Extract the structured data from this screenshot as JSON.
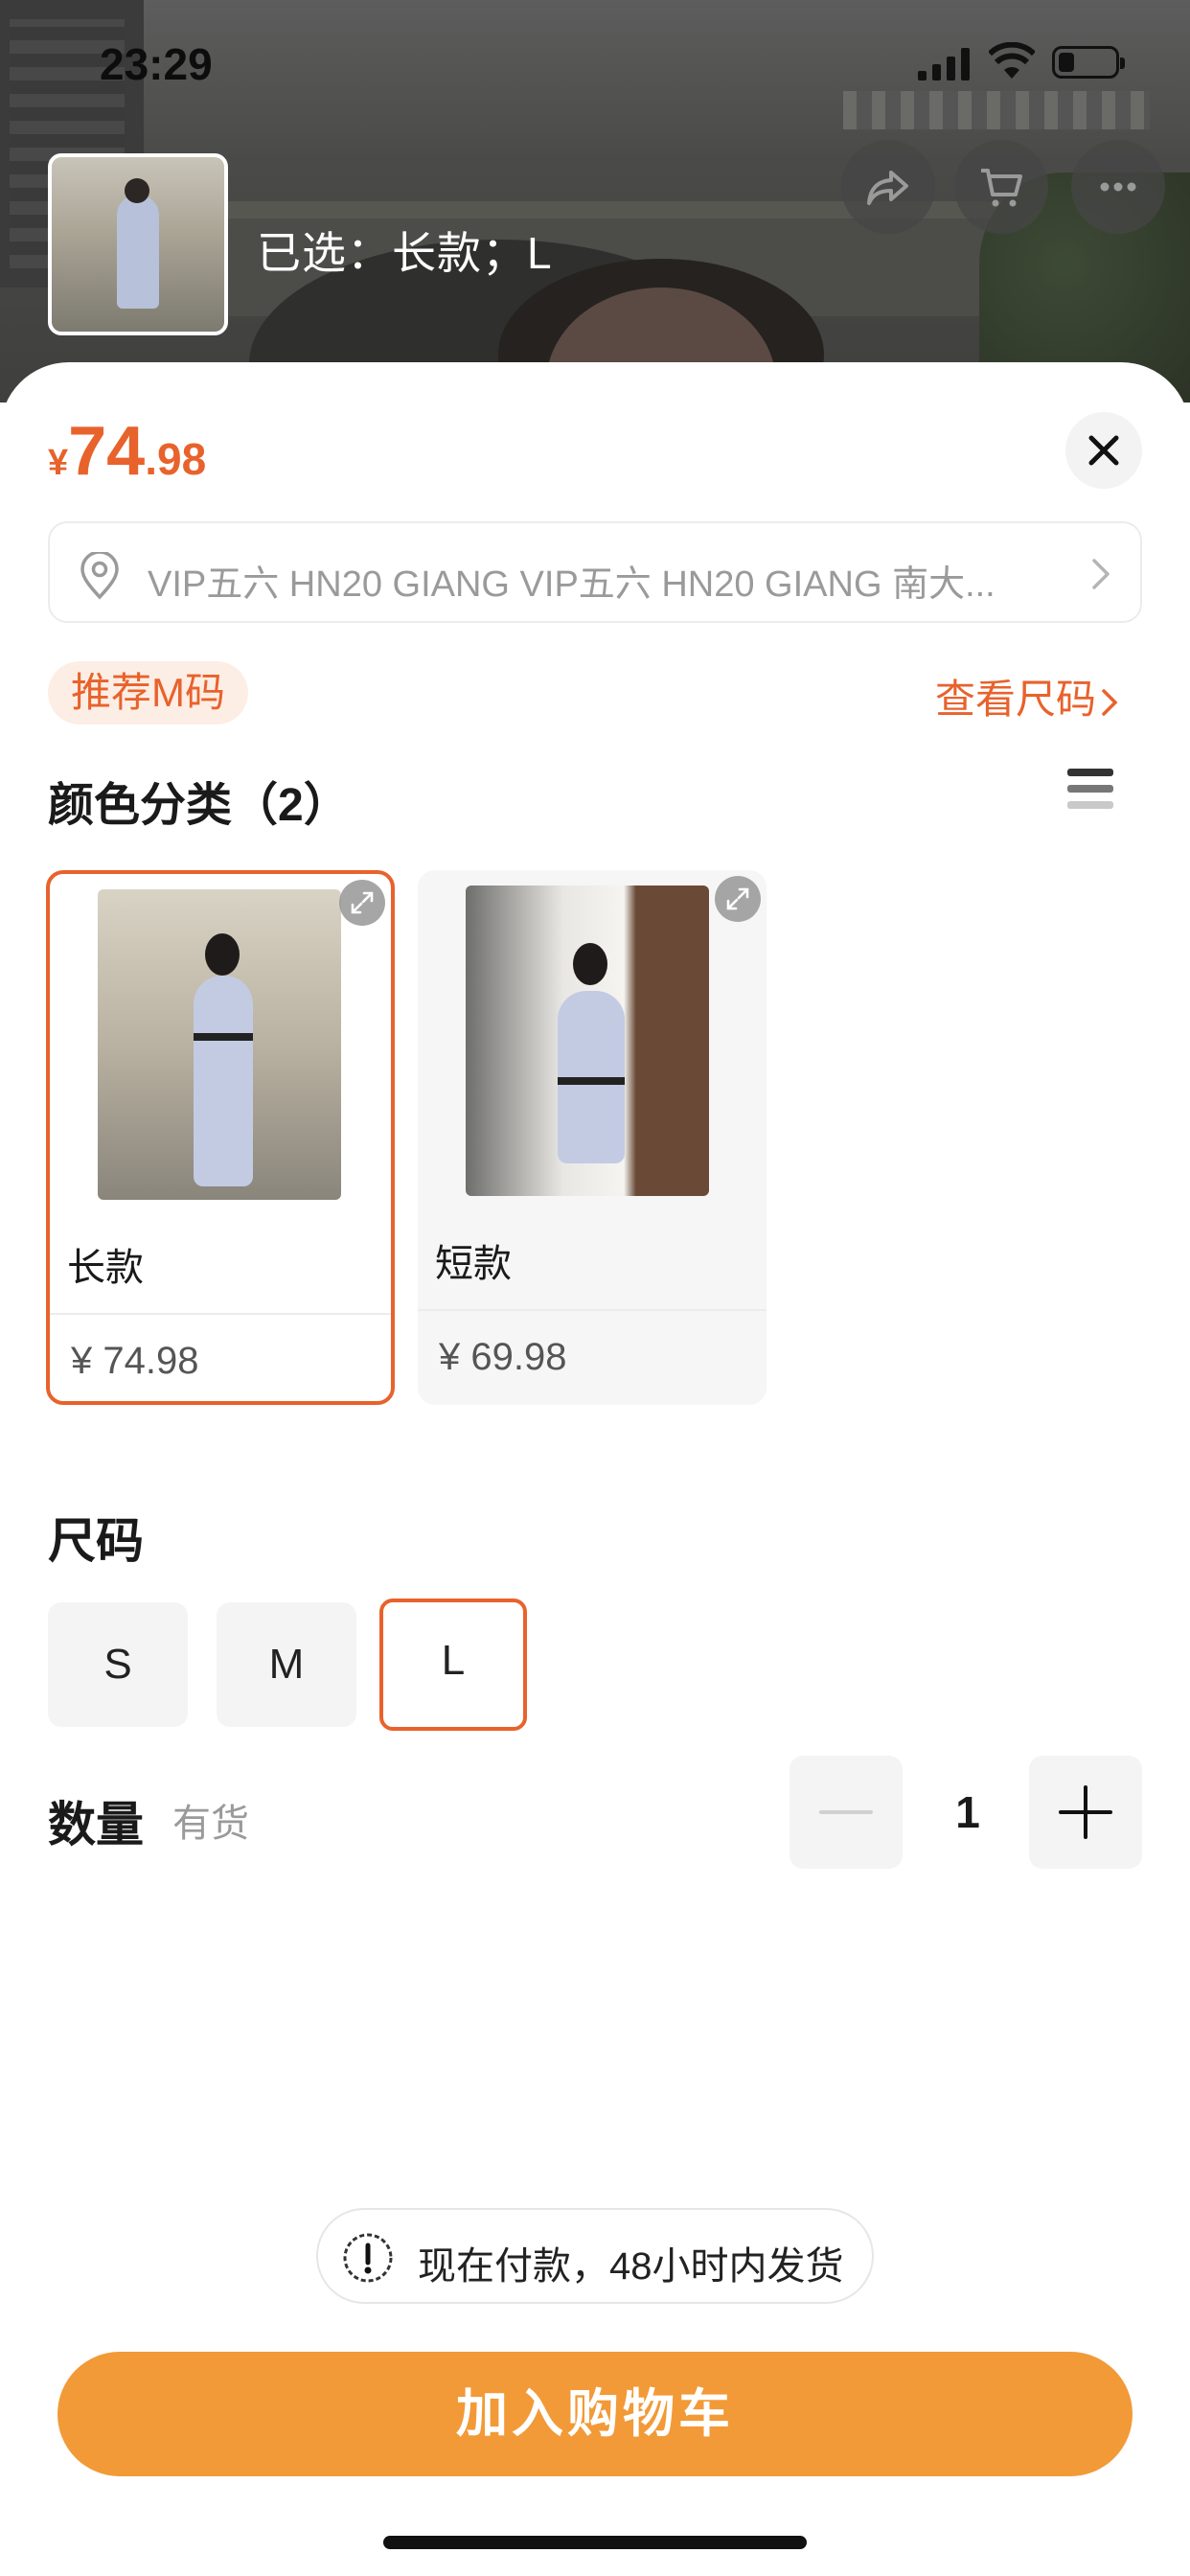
{
  "status_bar": {
    "time": "23:29"
  },
  "header": {
    "selected_text": "已选：长款；L"
  },
  "header_actions": [
    {
      "name": "share-icon"
    },
    {
      "name": "cart-icon"
    },
    {
      "name": "more-icon"
    }
  ],
  "price": {
    "currency": "¥",
    "integer": "74",
    "decimal": ".98",
    "color": "#e8622c"
  },
  "address": {
    "text": "VIP五六 HN20 GIANG VIP五六 HN20 GIANG 南大..."
  },
  "recommend_size": "推荐M码",
  "size_chart_link": "查看尺码",
  "color_section": {
    "title": "颜色分类（2）",
    "options": [
      {
        "name": "长款",
        "price": "¥ 74.98",
        "selected": true
      },
      {
        "name": "短款",
        "price": "¥ 69.98",
        "selected": false
      }
    ]
  },
  "size_section": {
    "title": "尺码",
    "options": [
      {
        "label": "S",
        "selected": false
      },
      {
        "label": "M",
        "selected": false
      },
      {
        "label": "L",
        "selected": true
      }
    ]
  },
  "quantity": {
    "title": "数量",
    "stock": "有货",
    "value": "1"
  },
  "notice": "现在付款，48小时内发货",
  "add_to_cart": "加入购物车",
  "accent_color": "#e8622c",
  "button_color": "#f29a37"
}
